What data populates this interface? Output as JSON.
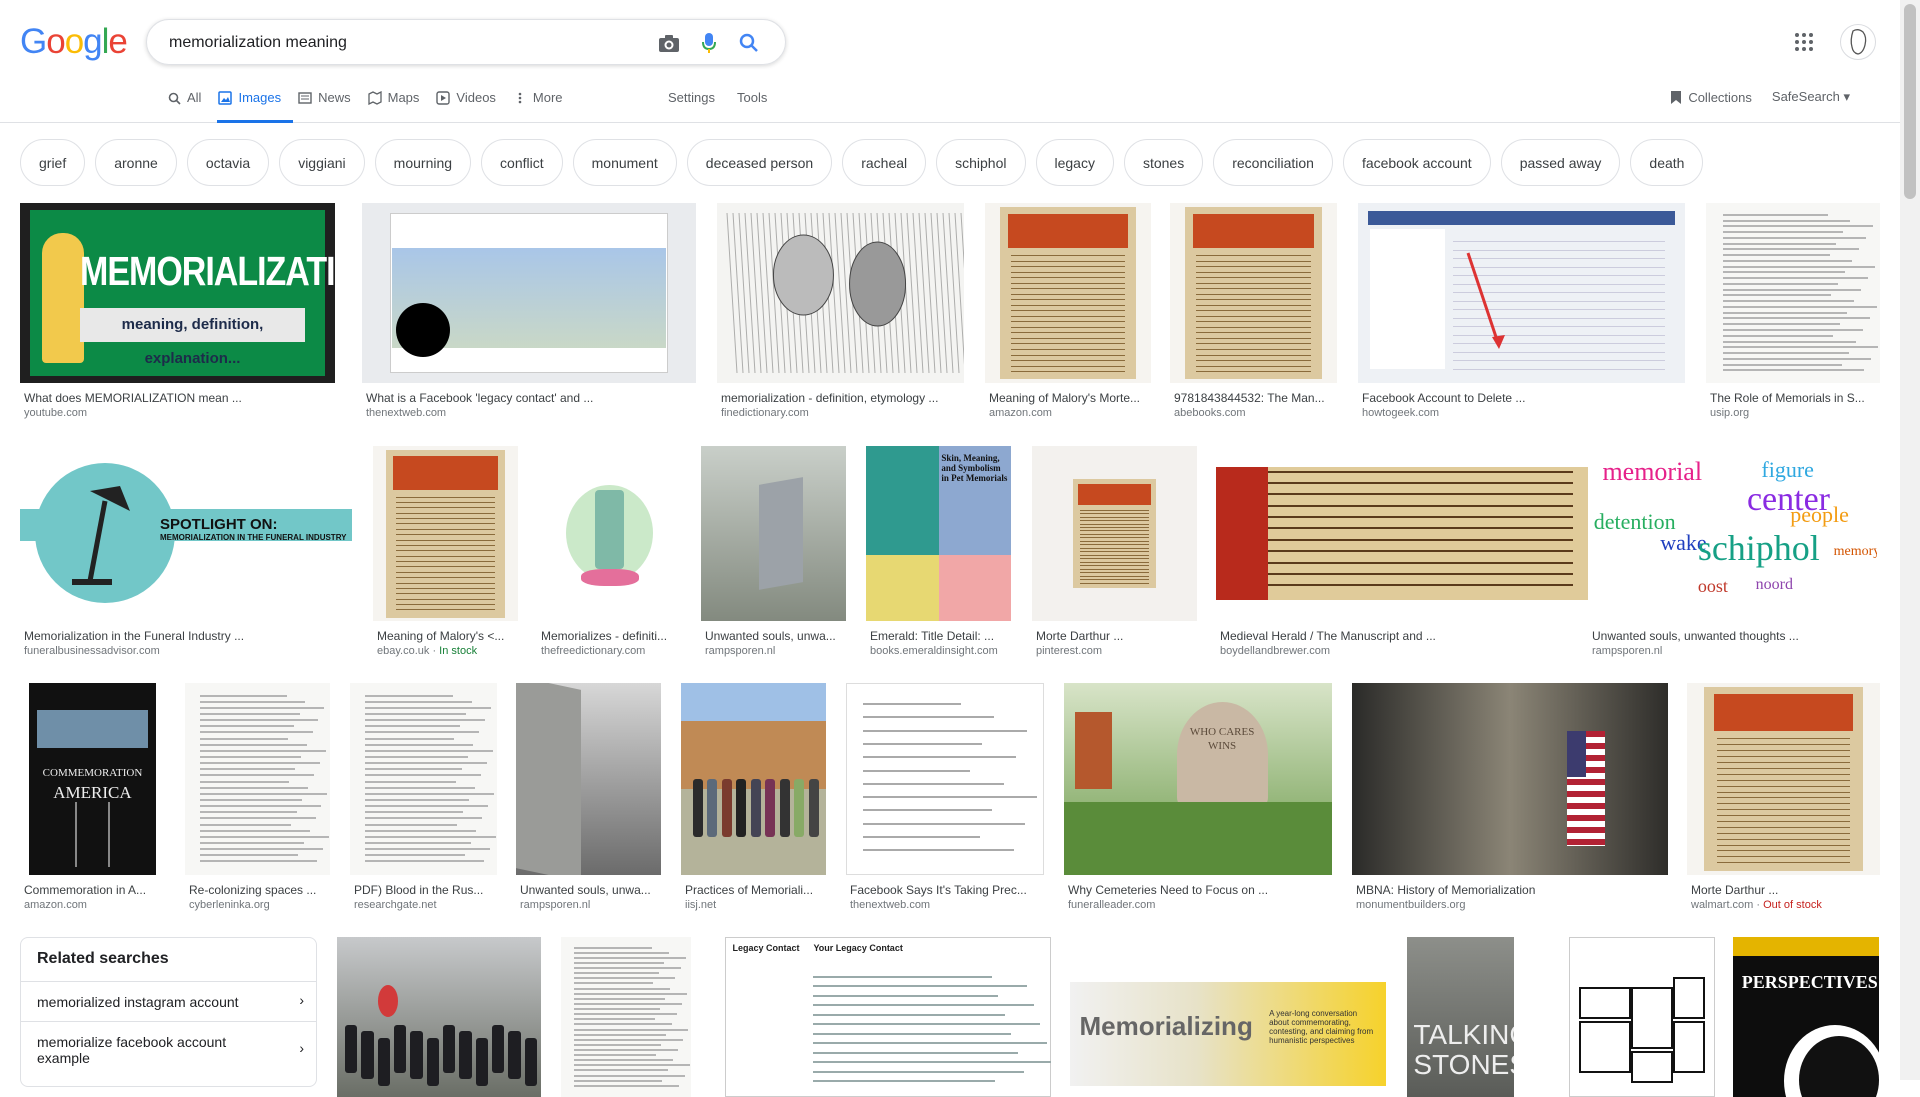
{
  "logo": {
    "letters": [
      "G",
      "o",
      "o",
      "g",
      "l",
      "e"
    ],
    "colors": [
      "#4285F4",
      "#EA4335",
      "#FBBC05",
      "#4285F4",
      "#34A853",
      "#EA4335"
    ]
  },
  "search": {
    "query": "memorialization meaning",
    "placeholder": ""
  },
  "tabs": [
    {
      "label": "All",
      "icon": "search-icon",
      "active": false
    },
    {
      "label": "Images",
      "icon": "image-icon",
      "active": true
    },
    {
      "label": "News",
      "icon": "news-icon",
      "active": false
    },
    {
      "label": "Maps",
      "icon": "map-icon",
      "active": false
    },
    {
      "label": "Videos",
      "icon": "video-icon",
      "active": false
    },
    {
      "label": "More",
      "icon": "more-vert-icon",
      "active": false
    }
  ],
  "tools": {
    "settings": "Settings",
    "tools": "Tools"
  },
  "right_links": {
    "collections": "Collections",
    "safesearch": "SafeSearch"
  },
  "chips": [
    "grief",
    "aronne",
    "octavia",
    "viggiani",
    "mourning",
    "conflict",
    "monument",
    "deceased person",
    "racheal",
    "schiphol",
    "legacy",
    "stones",
    "reconciliation",
    "facebook account",
    "passed away",
    "death"
  ],
  "row1": [
    {
      "title": "What does MEMORIALIZATION mean ...",
      "source": "youtube.com",
      "thumb": {
        "kind": "memorialization",
        "main": "MEMORIALIZATION",
        "sub": "meaning, definition, explanation..."
      }
    },
    {
      "title": "What is a Facebook 'legacy contact' and ...",
      "source": "thenextweb.com",
      "thumb": {
        "kind": "facebook"
      }
    },
    {
      "title": "memorialization - definition, etymology ...",
      "source": "finedictionary.com",
      "thumb": {
        "kind": "sketch"
      }
    },
    {
      "title": "Meaning of Malory's Morte...",
      "source": "amazon.com",
      "thumb": {
        "kind": "manuscript"
      }
    },
    {
      "title": "9781843844532: The Man...",
      "source": "abebooks.com",
      "thumb": {
        "kind": "manuscript"
      }
    },
    {
      "title": "Facebook Account to Delete ...",
      "source": "howtogeek.com",
      "thumb": {
        "kind": "settings"
      }
    },
    {
      "title": "The Role of Memorials in S...",
      "source": "usip.org",
      "thumb": {
        "kind": "doc"
      }
    }
  ],
  "row2": [
    {
      "title": "Memorialization in the Funeral Industry ...",
      "source": "funeralbusinessadvisor.com",
      "thumb": {
        "kind": "spotlight",
        "main": "SPOTLIGHT ON:",
        "sub": "MEMORIALIZATION IN THE FUNERAL INDUSTRY"
      }
    },
    {
      "title": "Meaning of Malory's <...",
      "source": "ebay.co.uk",
      "stock": "In stock",
      "thumb": {
        "kind": "manuscript"
      }
    },
    {
      "title": "Memorializes - definiti...",
      "source": "thefreedictionary.com",
      "thumb": {
        "kind": "monument"
      }
    },
    {
      "title": "Unwanted souls, unwa...",
      "source": "rampsporen.nl",
      "thumb": {
        "kind": "photo-grey"
      }
    },
    {
      "title": "Emerald: Title Detail: ...",
      "source": "books.emeraldinsight.com",
      "thumb": {
        "kind": "emerald",
        "main": "Skin, Meaning, and Symbolism in Pet Memorials"
      }
    },
    {
      "title": "Morte Darthur ...",
      "source": "pinterest.com",
      "thumb": {
        "kind": "manuscript-small"
      }
    },
    {
      "title": "Medieval Herald / The Manuscript and ...",
      "source": "boydellandbrewer.com",
      "thumb": {
        "kind": "herald"
      }
    },
    {
      "title": "Unwanted souls, unwanted thoughts ...",
      "source": "rampsporen.nl",
      "thumb": {
        "kind": "wordcloud",
        "words": [
          "memorial",
          "figure",
          "center",
          "people",
          "detention",
          "wake",
          "schiphol",
          "oost",
          "noord",
          "memory"
        ]
      }
    }
  ],
  "row3": [
    {
      "title": "Commemoration in A...",
      "source": "amazon.com",
      "thumb": {
        "kind": "commemoration",
        "main": "COMMEMORATION",
        "sub": "AMERICA"
      }
    },
    {
      "title": "Re-colonizing spaces ...",
      "source": "cyberleninka.org",
      "thumb": {
        "kind": "doc"
      }
    },
    {
      "title": "PDF) Blood in the Rus...",
      "source": "researchgate.net",
      "thumb": {
        "kind": "doc"
      }
    },
    {
      "title": "Unwanted souls, unwa...",
      "source": "rampsporen.nl",
      "thumb": {
        "kind": "wall"
      }
    },
    {
      "title": "Practices of Memoriali...",
      "source": "iisj.net",
      "thumb": {
        "kind": "group"
      }
    },
    {
      "title": "Facebook Says It's Taking Prec...",
      "source": "thenextweb.com",
      "thumb": {
        "kind": "form"
      }
    },
    {
      "title": "Why Cemeteries Need to Focus on ...",
      "source": "funeralleader.com",
      "thumb": {
        "kind": "garden",
        "main": "WHO CARES WINS"
      }
    },
    {
      "title": "MBNA: History of Memorialization",
      "source": "monumentbuilders.org",
      "thumb": {
        "kind": "flagwall"
      }
    },
    {
      "title": "Morte Darthur ...",
      "source": "walmart.com",
      "stock": "Out of stock",
      "thumb": {
        "kind": "manuscript"
      }
    }
  ],
  "row4": [
    {
      "thumb": {
        "kind": "crowd"
      }
    },
    {
      "thumb": {
        "kind": "doc"
      }
    },
    {
      "thumb": {
        "kind": "legacy",
        "main": "Legacy Contact",
        "sub": "Your Legacy Contact"
      }
    },
    {
      "thumb": {
        "kind": "memorializing",
        "main": "Memorializing",
        "sub": "A year-long conversation about commemorating, contesting, and claiming from humanistic perspectives"
      }
    },
    {
      "thumb": {
        "kind": "stones",
        "main": "TALKING STONES"
      }
    },
    {
      "thumb": {
        "kind": "grid"
      }
    },
    {
      "thumb": {
        "kind": "perspectives",
        "main": "PERSPECTIVES"
      }
    }
  ],
  "related": {
    "title": "Related searches",
    "items": [
      "memorialized instagram account",
      "memorialize facebook account example"
    ]
  }
}
